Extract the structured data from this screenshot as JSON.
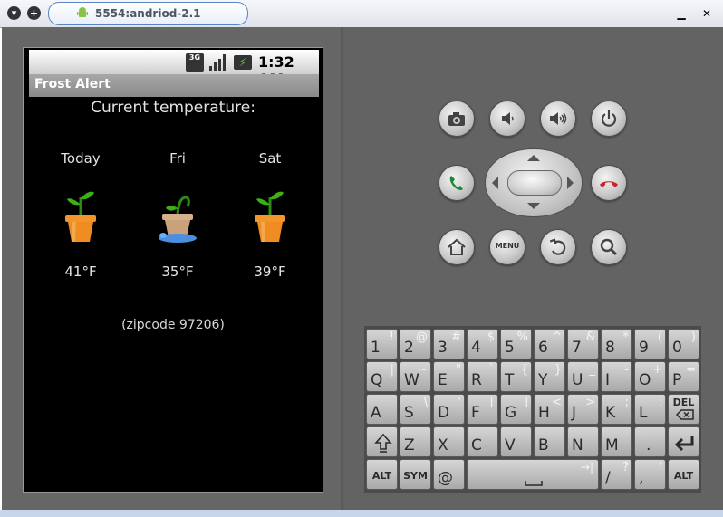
{
  "window": {
    "title": "5554:andriod-2.1",
    "menu_icon": "chevron-down-icon",
    "add_icon": "plus-icon",
    "minimize_label": "▁",
    "restore_label": "☐",
    "close_label": "✕"
  },
  "statusbar": {
    "network": "3G",
    "time": "1:32 AM"
  },
  "app": {
    "title": "Frost Alert",
    "heading": "Current temperature:",
    "days": [
      {
        "name": "Today",
        "temp": "41°F",
        "icon": "plant-pot-healthy-icon"
      },
      {
        "name": "Fri",
        "temp": "35°F",
        "icon": "plant-pot-wilted-icon"
      },
      {
        "name": "Sat",
        "temp": "39°F",
        "icon": "plant-pot-healthy-icon"
      }
    ],
    "zip": "(zipcode 97206)"
  },
  "controls": {
    "row1": [
      "camera-icon",
      "volume-down-icon",
      "volume-up-icon",
      "power-icon"
    ],
    "call": "call-icon",
    "end_call": "end-call-icon",
    "row3": [
      "home-icon",
      "menu-button",
      "back-icon",
      "search-icon"
    ],
    "menu_label": "MENU"
  },
  "keyboard": {
    "row1": [
      {
        "k": "1",
        "a": "!"
      },
      {
        "k": "2",
        "a": "@"
      },
      {
        "k": "3",
        "a": "#"
      },
      {
        "k": "4",
        "a": "$"
      },
      {
        "k": "5",
        "a": "%"
      },
      {
        "k": "6",
        "a": "^"
      },
      {
        "k": "7",
        "a": "&"
      },
      {
        "k": "8",
        "a": "*"
      },
      {
        "k": "9",
        "a": "("
      },
      {
        "k": "0",
        "a": ")"
      }
    ],
    "row2": [
      {
        "k": "Q",
        "a": "|"
      },
      {
        "k": "W",
        "a": "~"
      },
      {
        "k": "E",
        "a": "\""
      },
      {
        "k": "R",
        "a": "`"
      },
      {
        "k": "T",
        "a": "{"
      },
      {
        "k": "Y",
        "a": "}"
      },
      {
        "k": "U",
        "a": "_"
      },
      {
        "k": "I",
        "a": "-"
      },
      {
        "k": "O",
        "a": "+"
      },
      {
        "k": "P",
        "a": "="
      }
    ],
    "row3": [
      {
        "k": "A",
        "a": ""
      },
      {
        "k": "S",
        "a": "\\"
      },
      {
        "k": "D",
        "a": "'"
      },
      {
        "k": "F",
        "a": "["
      },
      {
        "k": "G",
        "a": "]"
      },
      {
        "k": "H",
        "a": "<"
      },
      {
        "k": "J",
        "a": ">"
      },
      {
        "k": "K",
        "a": ";"
      },
      {
        "k": "L",
        "a": ":"
      },
      {
        "k": "DEL",
        "a": ""
      }
    ],
    "row4": [
      {
        "k": "shift",
        "a": ""
      },
      {
        "k": "Z",
        "a": ""
      },
      {
        "k": "X",
        "a": ""
      },
      {
        "k": "C",
        "a": ""
      },
      {
        "k": "V",
        "a": ""
      },
      {
        "k": "B",
        "a": ""
      },
      {
        "k": "N",
        "a": ""
      },
      {
        "k": "M",
        "a": ""
      },
      {
        "k": ".",
        "a": ""
      },
      {
        "k": "enter",
        "a": ""
      }
    ],
    "row5": {
      "alt_left": "ALT",
      "sym": "SYM",
      "at": "@",
      "space_alt": "→|",
      "slash": "/",
      "slash_alt": "?",
      "comma": ",",
      "comma_alt": "'",
      "alt_right": "ALT"
    }
  }
}
